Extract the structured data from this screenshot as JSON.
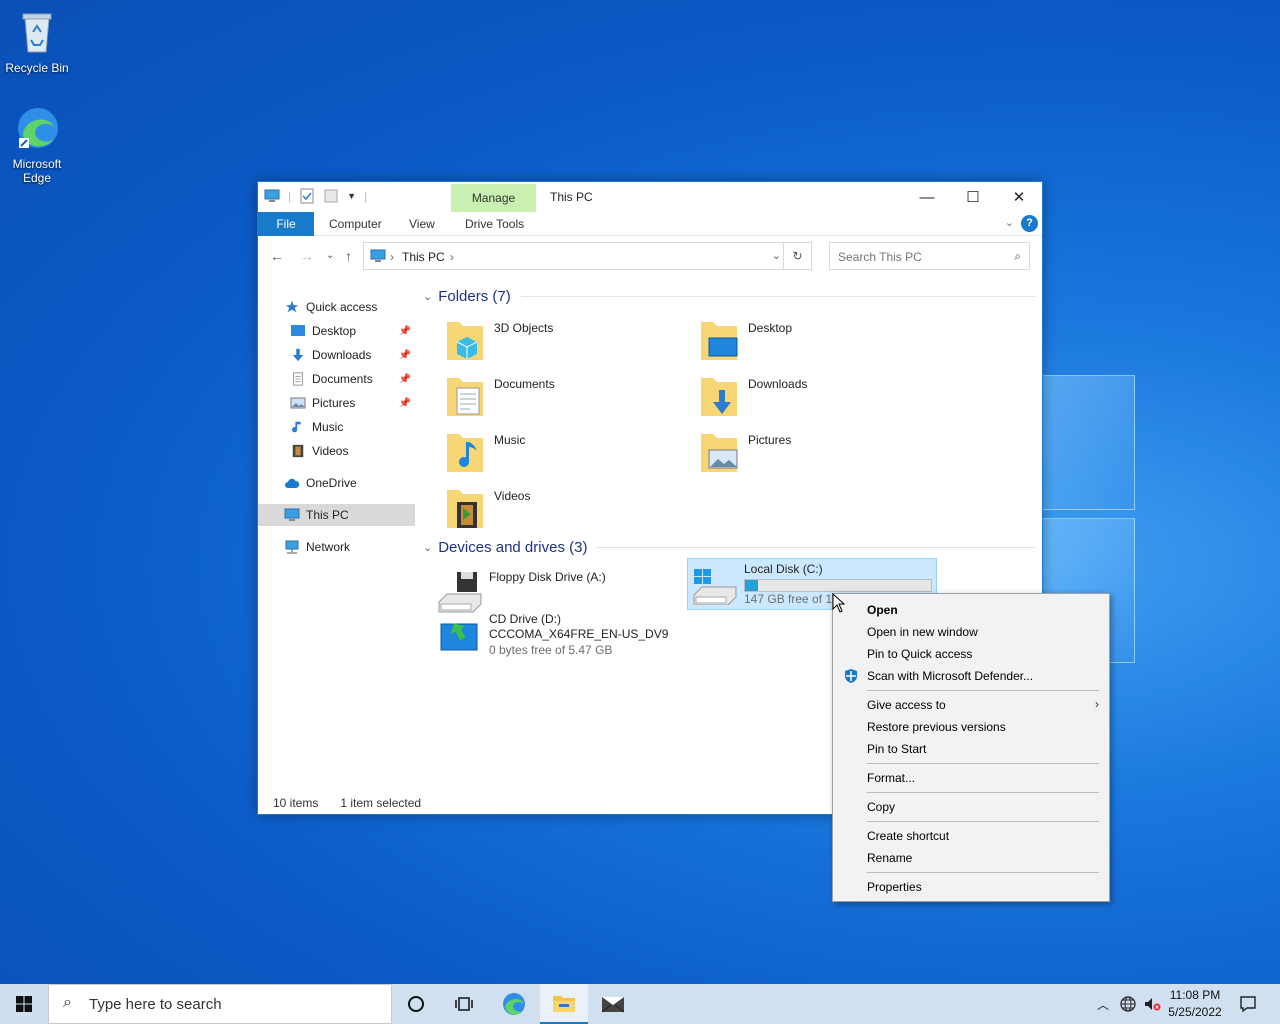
{
  "desktop": {
    "icons": [
      {
        "label": "Recycle Bin"
      },
      {
        "label": "Microsoft Edge"
      }
    ]
  },
  "explorer": {
    "title": "This PC",
    "contextual_tab": "Manage",
    "ribbon_tabs": [
      "File",
      "Computer",
      "View",
      "Drive Tools"
    ],
    "address": {
      "segment": "This PC"
    },
    "search_placeholder": "Search This PC",
    "nav": {
      "quick_access": "Quick access",
      "items": [
        "Desktop",
        "Downloads",
        "Documents",
        "Pictures",
        "Music",
        "Videos"
      ],
      "onedrive": "OneDrive",
      "this_pc": "This PC",
      "network": "Network"
    },
    "groups": {
      "folders": "Folders (7)",
      "devices": "Devices and drives (3)"
    },
    "folders": [
      "3D Objects",
      "Desktop",
      "Documents",
      "Downloads",
      "Music",
      "Pictures",
      "Videos"
    ],
    "drives": {
      "floppy": {
        "name": "Floppy Disk Drive (A:)"
      },
      "local": {
        "name": "Local Disk (C:)",
        "free": "147 GB free of 15",
        "used_fraction": 0.07
      },
      "cd": {
        "name": "CD Drive (D:)",
        "label": "CCCOMA_X64FRE_EN-US_DV9",
        "free": "0 bytes free of 5.47 GB"
      }
    },
    "status": {
      "items": "10 items",
      "selected": "1 item selected"
    }
  },
  "context_menu": {
    "open": "Open",
    "open_new_window": "Open in new window",
    "pin_quick": "Pin to Quick access",
    "scan": "Scan with Microsoft Defender...",
    "give_access": "Give access to",
    "restore": "Restore previous versions",
    "pin_start": "Pin to Start",
    "format": "Format...",
    "copy": "Copy",
    "create_shortcut": "Create shortcut",
    "rename": "Rename",
    "properties": "Properties"
  },
  "taskbar": {
    "search_placeholder": "Type here to search",
    "time": "11:08 PM",
    "date": "5/25/2022"
  },
  "colors": {
    "accent": "#1979ca",
    "manage_tab": "#c9f0b0",
    "selection": "#cce8ff"
  }
}
